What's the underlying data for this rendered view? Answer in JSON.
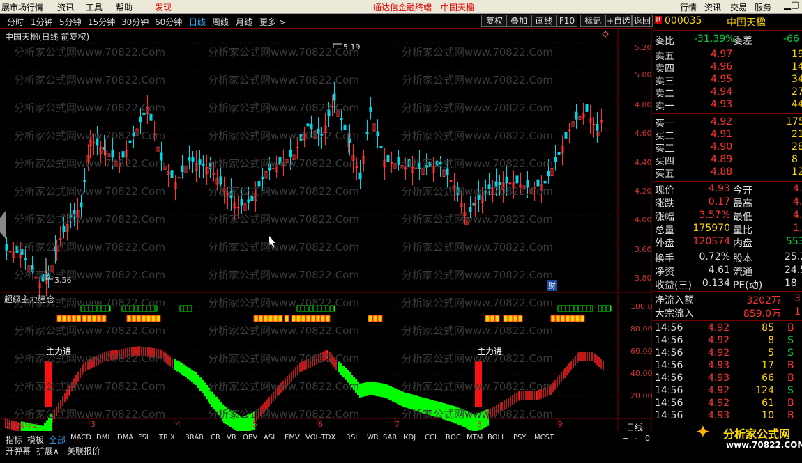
{
  "menubar": {
    "items": [
      "展市场行情",
      "资讯",
      "工具",
      "帮助"
    ],
    "discover": "发现",
    "center": "通达信金融终端",
    "center_stock": "中国天楹",
    "right": [
      "行情",
      "资讯",
      "交易",
      "服务"
    ]
  },
  "periods": [
    "分时",
    "1分钟",
    "5分钟",
    "15分钟",
    "30分钟",
    "60分钟",
    "日线",
    "周线",
    "月线",
    "更多 >"
  ],
  "active_period": "日线",
  "toolbar": [
    "复权",
    "叠加",
    "画线",
    "F10",
    "标记",
    "+自选",
    "返回"
  ],
  "chart_title": "中国天楹(日线 前复权)",
  "watermark": "分析家公式网www.70822.Com",
  "indicator_title": "超级主力建仓",
  "zhulijin": "主力进",
  "cai": "财",
  "annot_high": "5.19",
  "annot_low": "3.56",
  "price_axis": [
    "5.20",
    "5.00",
    "4.80",
    "4.60",
    "4.40",
    "4.20",
    "4.00",
    "3.80",
    "3.60"
  ],
  "ind_axis": [
    "100.0",
    "80.00",
    "60.00",
    "40.00",
    "20.00"
  ],
  "date_axis": [
    "2021年2",
    "3",
    "4",
    "5",
    "6",
    "7",
    "8",
    "9"
  ],
  "bottom_tabs": [
    "指标",
    "模板",
    "全部",
    "MACD",
    "DMI",
    "DMA",
    "FSL",
    "TRIX",
    "BRAR",
    "CR",
    "VR",
    "OBV",
    "ASI",
    "EMV",
    "VOL-TDX",
    "RSI",
    "WR",
    "SAR",
    "KDJ",
    "CCI",
    "ROC",
    "MTM",
    "BOLL",
    "PSY",
    "MCST"
  ],
  "bottom_row2": [
    "开弹幕",
    "扩展∧",
    "关联报价"
  ],
  "dayline": "日线",
  "zoom": [
    "+",
    "-",
    "0"
  ],
  "panel": {
    "code": "000035",
    "name": "中国天楹",
    "weibi_label": "委比",
    "weibi": "-31.39%",
    "weicha_label": "委差",
    "weicha": "-66",
    "sells": [
      {
        "l": "卖五",
        "p": "4.97",
        "v": "19"
      },
      {
        "l": "卖四",
        "p": "4.96",
        "v": "14"
      },
      {
        "l": "卖三",
        "p": "4.95",
        "v": "34"
      },
      {
        "l": "卖二",
        "p": "4.94",
        "v": "27"
      },
      {
        "l": "卖一",
        "p": "4.93",
        "v": "44"
      }
    ],
    "buys": [
      {
        "l": "买一",
        "p": "4.92",
        "v": "175"
      },
      {
        "l": "买二",
        "p": "4.91",
        "v": "21"
      },
      {
        "l": "买三",
        "p": "4.90",
        "v": "28"
      },
      {
        "l": "买四",
        "p": "4.89",
        "v": "8"
      },
      {
        "l": "买五",
        "p": "4.88",
        "v": "12"
      }
    ],
    "stats": [
      {
        "a": "现价",
        "av": "4.93",
        "b": "今开",
        "bv": "4."
      },
      {
        "a": "涨跌",
        "av": "0.17",
        "b": "最高",
        "bv": "4."
      },
      {
        "a": "涨幅",
        "av": "3.57%",
        "b": "最低",
        "bv": "4."
      },
      {
        "a": "总量",
        "av": "175970",
        "b": "量比",
        "bv": "1."
      },
      {
        "a": "外盘",
        "av": "120574",
        "b": "内盘",
        "bv": "553"
      }
    ],
    "stats2": [
      {
        "a": "换手",
        "av": "0.72%",
        "b": "股本",
        "bv": "25.2"
      },
      {
        "a": "净资",
        "av": "4.61",
        "b": "流通",
        "bv": "24.5"
      },
      {
        "a": "收益(三)",
        "av": "0.134",
        "b": "PE(动)",
        "bv": "18"
      }
    ],
    "flow": [
      {
        "l": "净流入额",
        "v": "3202万",
        "x": "3"
      },
      {
        "l": "大宗流入",
        "v": "859.0万",
        "x": "1"
      }
    ],
    "ticks": [
      {
        "t": "14:56",
        "p": "4.92",
        "v": "85",
        "s": "B"
      },
      {
        "t": "14:56",
        "p": "4.92",
        "v": "8",
        "s": "S"
      },
      {
        "t": "14:56",
        "p": "4.92",
        "v": "5",
        "s": "S"
      },
      {
        "t": "14:56",
        "p": "4.93",
        "v": "17",
        "s": "B"
      },
      {
        "t": "14:56",
        "p": "4.93",
        "v": "66",
        "s": "B"
      },
      {
        "t": "14:56",
        "p": "4.92",
        "v": "124",
        "s": "S"
      },
      {
        "t": "14:56",
        "p": "4.92",
        "v": "61",
        "s": "B"
      },
      {
        "t": "14:56",
        "p": "4.93",
        "v": "10",
        "s": "B"
      }
    ],
    "logo": "分析家公式网",
    "logo_url": "www.70822.COM"
  },
  "colors": {
    "up": "#ff3232",
    "down": "#00d8e8",
    "green": "#00ff00",
    "bg": "#000000"
  }
}
